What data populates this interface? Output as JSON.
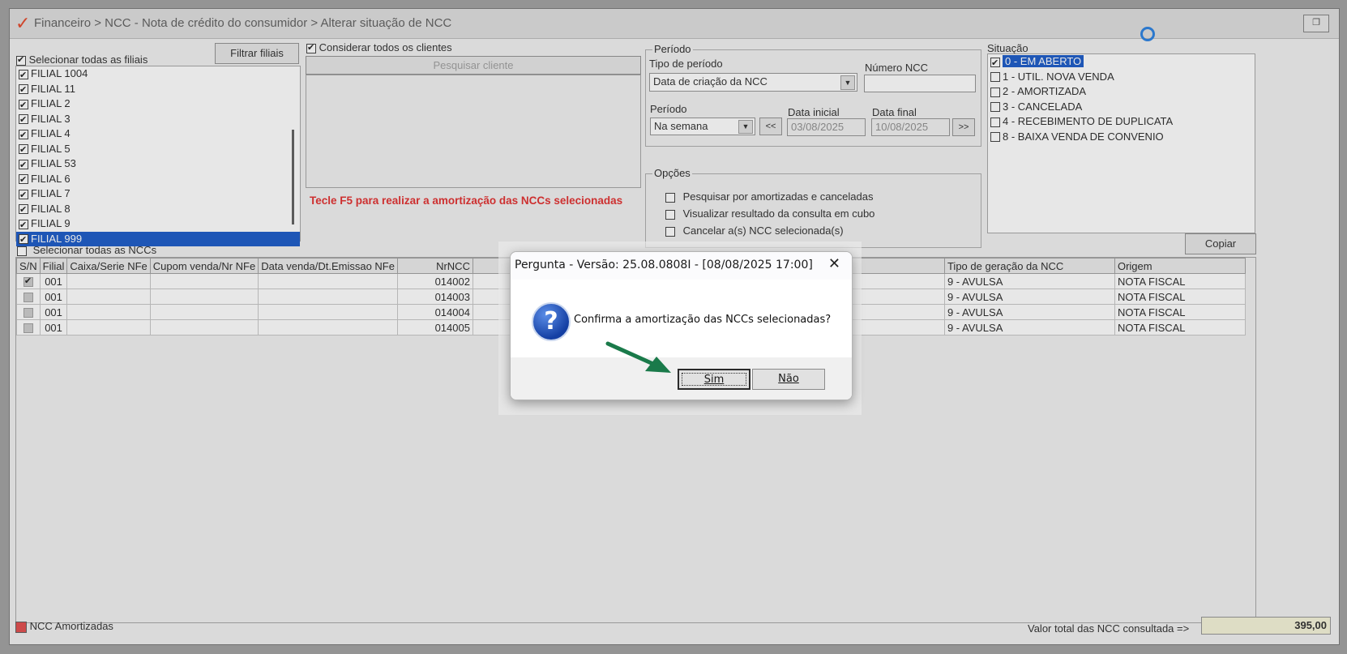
{
  "window": {
    "title": "Financeiro > NCC - Nota de crédito do consumidor > Alterar situação de NCC",
    "restore_icon": "restore-icon"
  },
  "branches": {
    "select_all_label": "Selecionar todas as filiais",
    "filter_button": "Filtrar filiais",
    "items": [
      {
        "label": "FILIAL 1004",
        "checked": true
      },
      {
        "label": "FILIAL 11",
        "checked": true
      },
      {
        "label": "FILIAL 2",
        "checked": true
      },
      {
        "label": "FILIAL 3",
        "checked": true
      },
      {
        "label": "FILIAL 4",
        "checked": true
      },
      {
        "label": "FILIAL 5",
        "checked": true
      },
      {
        "label": "FILIAL 53",
        "checked": true
      },
      {
        "label": "FILIAL 6",
        "checked": true
      },
      {
        "label": "FILIAL 7",
        "checked": true
      },
      {
        "label": "FILIAL 8",
        "checked": true
      },
      {
        "label": "FILIAL 9",
        "checked": true
      },
      {
        "label": "FILIAL 999",
        "checked": true,
        "selected": true
      }
    ]
  },
  "clients": {
    "consider_all_label": "Considerar todos os clientes",
    "search_button": "Pesquisar cliente"
  },
  "f5_hint": "Tecle F5 para realizar a amortização das NCCs selecionadas",
  "period": {
    "group_title": "Período",
    "type_label": "Tipo de período",
    "type_value": "Data de criação da NCC",
    "ncc_number_label": "Número NCC",
    "ncc_number_value": "",
    "period_label": "Período",
    "period_value": "Na semana",
    "prev_button": "<<",
    "next_button": ">>",
    "start_label": "Data inicial",
    "start_value": "03/08/2025",
    "end_label": "Data final",
    "end_value": "10/08/2025"
  },
  "options": {
    "group_title": "Opções",
    "items": [
      "Pesquisar por amortizadas e canceladas",
      "Visualizar resultado da consulta em cubo",
      "Cancelar a(s) NCC selecionada(s)"
    ]
  },
  "situation": {
    "label": "Situação",
    "items": [
      {
        "label": "0 - EM ABERTO",
        "checked": true,
        "selected": true
      },
      {
        "label": "1 - UTIL. NOVA VENDA",
        "checked": false
      },
      {
        "label": "2 - AMORTIZADA",
        "checked": false
      },
      {
        "label": "3 - CANCELADA",
        "checked": false
      },
      {
        "label": "4 - RECEBIMENTO DE DUPLICATA",
        "checked": false
      },
      {
        "label": "8 - BAIXA VENDA DE CONVENIO",
        "checked": false
      }
    ]
  },
  "copy_button": "Copiar",
  "select_all_nccs_label": "Selecionar todas as NCCs",
  "table": {
    "columns": [
      "S/N",
      "Filial",
      "Caixa/Serie NFe",
      "Cupom venda/Nr NFe",
      "Data venda/Dt.Emissao NFe",
      "NrNCC",
      "",
      "Tipo de geração da NCC",
      "Origem"
    ],
    "rows": [
      {
        "checked": true,
        "filial": "001",
        "caixa": "",
        "cupom": "",
        "data": "",
        "nr": "014002",
        "hidden": "",
        "tipo": "9 - AVULSA",
        "origem": "NOTA FISCAL"
      },
      {
        "checked": false,
        "filial": "001",
        "caixa": "",
        "cupom": "",
        "data": "",
        "nr": "014003",
        "hidden": "",
        "tipo": "9 - AVULSA",
        "origem": "NOTA FISCAL"
      },
      {
        "checked": false,
        "filial": "001",
        "caixa": "",
        "cupom": "",
        "data": "",
        "nr": "014004",
        "hidden": "",
        "tipo": "9 - AVULSA",
        "origem": "NOTA FISCAL"
      },
      {
        "checked": false,
        "filial": "001",
        "caixa": "",
        "cupom": "",
        "data": "",
        "nr": "014005",
        "hidden": "",
        "tipo": "9 - AVULSA",
        "origem": "NOTA FISCAL"
      }
    ]
  },
  "footer": {
    "legend_label": "NCC Amortizadas",
    "legend_color": "#e04040",
    "total_label": "Valor total das NCC consultada =>",
    "total_value": "395,00"
  },
  "dialog": {
    "title": "Pergunta - Versão: 25.08.0808I - [08/08/2025 17:00]",
    "close": "✕",
    "icon": "question-icon",
    "message": "Confirma a amortização das NCCs selecionadas?",
    "yes_label": "Sim",
    "no_label": "Não"
  },
  "colors": {
    "selection": "#0a4fc4",
    "hint_red": "#e02020",
    "arrow_green": "#1a7a4a"
  }
}
